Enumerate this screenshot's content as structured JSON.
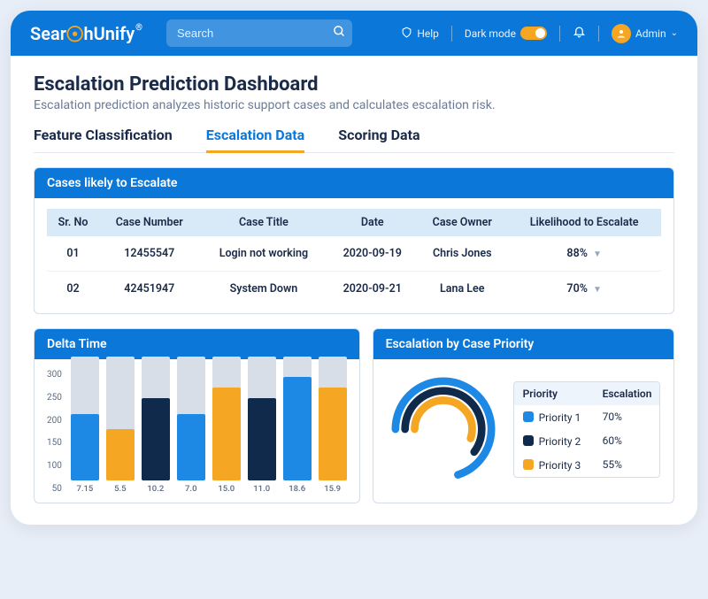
{
  "brand": {
    "part1": "Sear",
    "part2": "hUnify"
  },
  "search": {
    "placeholder": "Search"
  },
  "topbar": {
    "help": "Help",
    "dark_mode": "Dark mode",
    "admin": "Admin"
  },
  "page": {
    "title": "Escalation Prediction Dashboard",
    "subtitle": "Escalation prediction analyzes historic support cases and calculates escalation risk."
  },
  "tabs": [
    {
      "label": "Feature Classification",
      "active": false
    },
    {
      "label": "Escalation Data",
      "active": true
    },
    {
      "label": "Scoring Data",
      "active": false
    }
  ],
  "cases_panel": {
    "title": "Cases likely to Escalate",
    "columns": [
      "Sr. No",
      "Case Number",
      "Case Title",
      "Date",
      "Case Owner",
      "Likelihood to Escalate"
    ],
    "rows": [
      {
        "sr": "01",
        "num": "12455547",
        "title": "Login not working",
        "date": "2020-09-19",
        "owner": "Chris Jones",
        "pct": "88%"
      },
      {
        "sr": "02",
        "num": "42451947",
        "title": "System Down",
        "date": "2020-09-21",
        "owner": "Lana Lee",
        "pct": "70%"
      }
    ]
  },
  "delta_panel": {
    "title": "Delta Time"
  },
  "priority_panel": {
    "title": "Escalation by Case Priority",
    "legend_headers": {
      "priority": "Priority",
      "escalation": "Escalation"
    },
    "rows": [
      {
        "label": "Priority 1",
        "pct": "70%",
        "color": "#1e88e5"
      },
      {
        "label": "Priority 2",
        "pct": "60%",
        "color": "#0f2a4a"
      },
      {
        "label": "Priority 3",
        "pct": "55%",
        "color": "#f5a623"
      }
    ]
  },
  "chart_data": [
    {
      "type": "bar",
      "title": "Delta Time",
      "ylim": [
        0,
        300
      ],
      "yticks": [
        300,
        250,
        200,
        150,
        100,
        50
      ],
      "categories": [
        "7.15",
        "5.5",
        "10.2",
        "7.0",
        "15.0",
        "11.0",
        "18.6",
        "15.9"
      ],
      "values": [
        160,
        125,
        200,
        160,
        225,
        200,
        250,
        225
      ],
      "colors": [
        "#1e88e5",
        "#f5a623",
        "#0f2a4a",
        "#1e88e5",
        "#f5a623",
        "#0f2a4a",
        "#1e88e5",
        "#f5a623"
      ]
    },
    {
      "type": "donut",
      "title": "Escalation by Case Priority",
      "series": [
        {
          "name": "Priority 1",
          "value": 70,
          "color": "#1e88e5"
        },
        {
          "name": "Priority 2",
          "value": 60,
          "color": "#0f2a4a"
        },
        {
          "name": "Priority 3",
          "value": 55,
          "color": "#f5a623"
        }
      ]
    }
  ]
}
